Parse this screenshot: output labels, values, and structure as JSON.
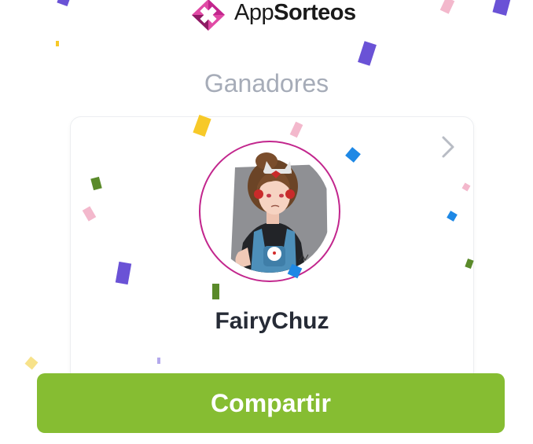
{
  "brand": {
    "name_part1": "App",
    "name_part2": "Sorteos",
    "logo_icon": "appsorteos-logo-icon",
    "colors": {
      "logo_dark": "#8e1a64",
      "logo_light": "#e04aa5"
    }
  },
  "page": {
    "section_title": "Ganadores"
  },
  "winner": {
    "name": "FairyChuz",
    "avatar_icon": "winner-avatar",
    "ring_color": "#c2268d",
    "next_icon": "chevron-right-icon"
  },
  "actions": {
    "share_label": "Compartir",
    "share_color": "#86bd32"
  },
  "confetti_colors": [
    "#6a52d6",
    "#f3b8cc",
    "#f7c928",
    "#1e88e5",
    "#5a8a2a"
  ]
}
